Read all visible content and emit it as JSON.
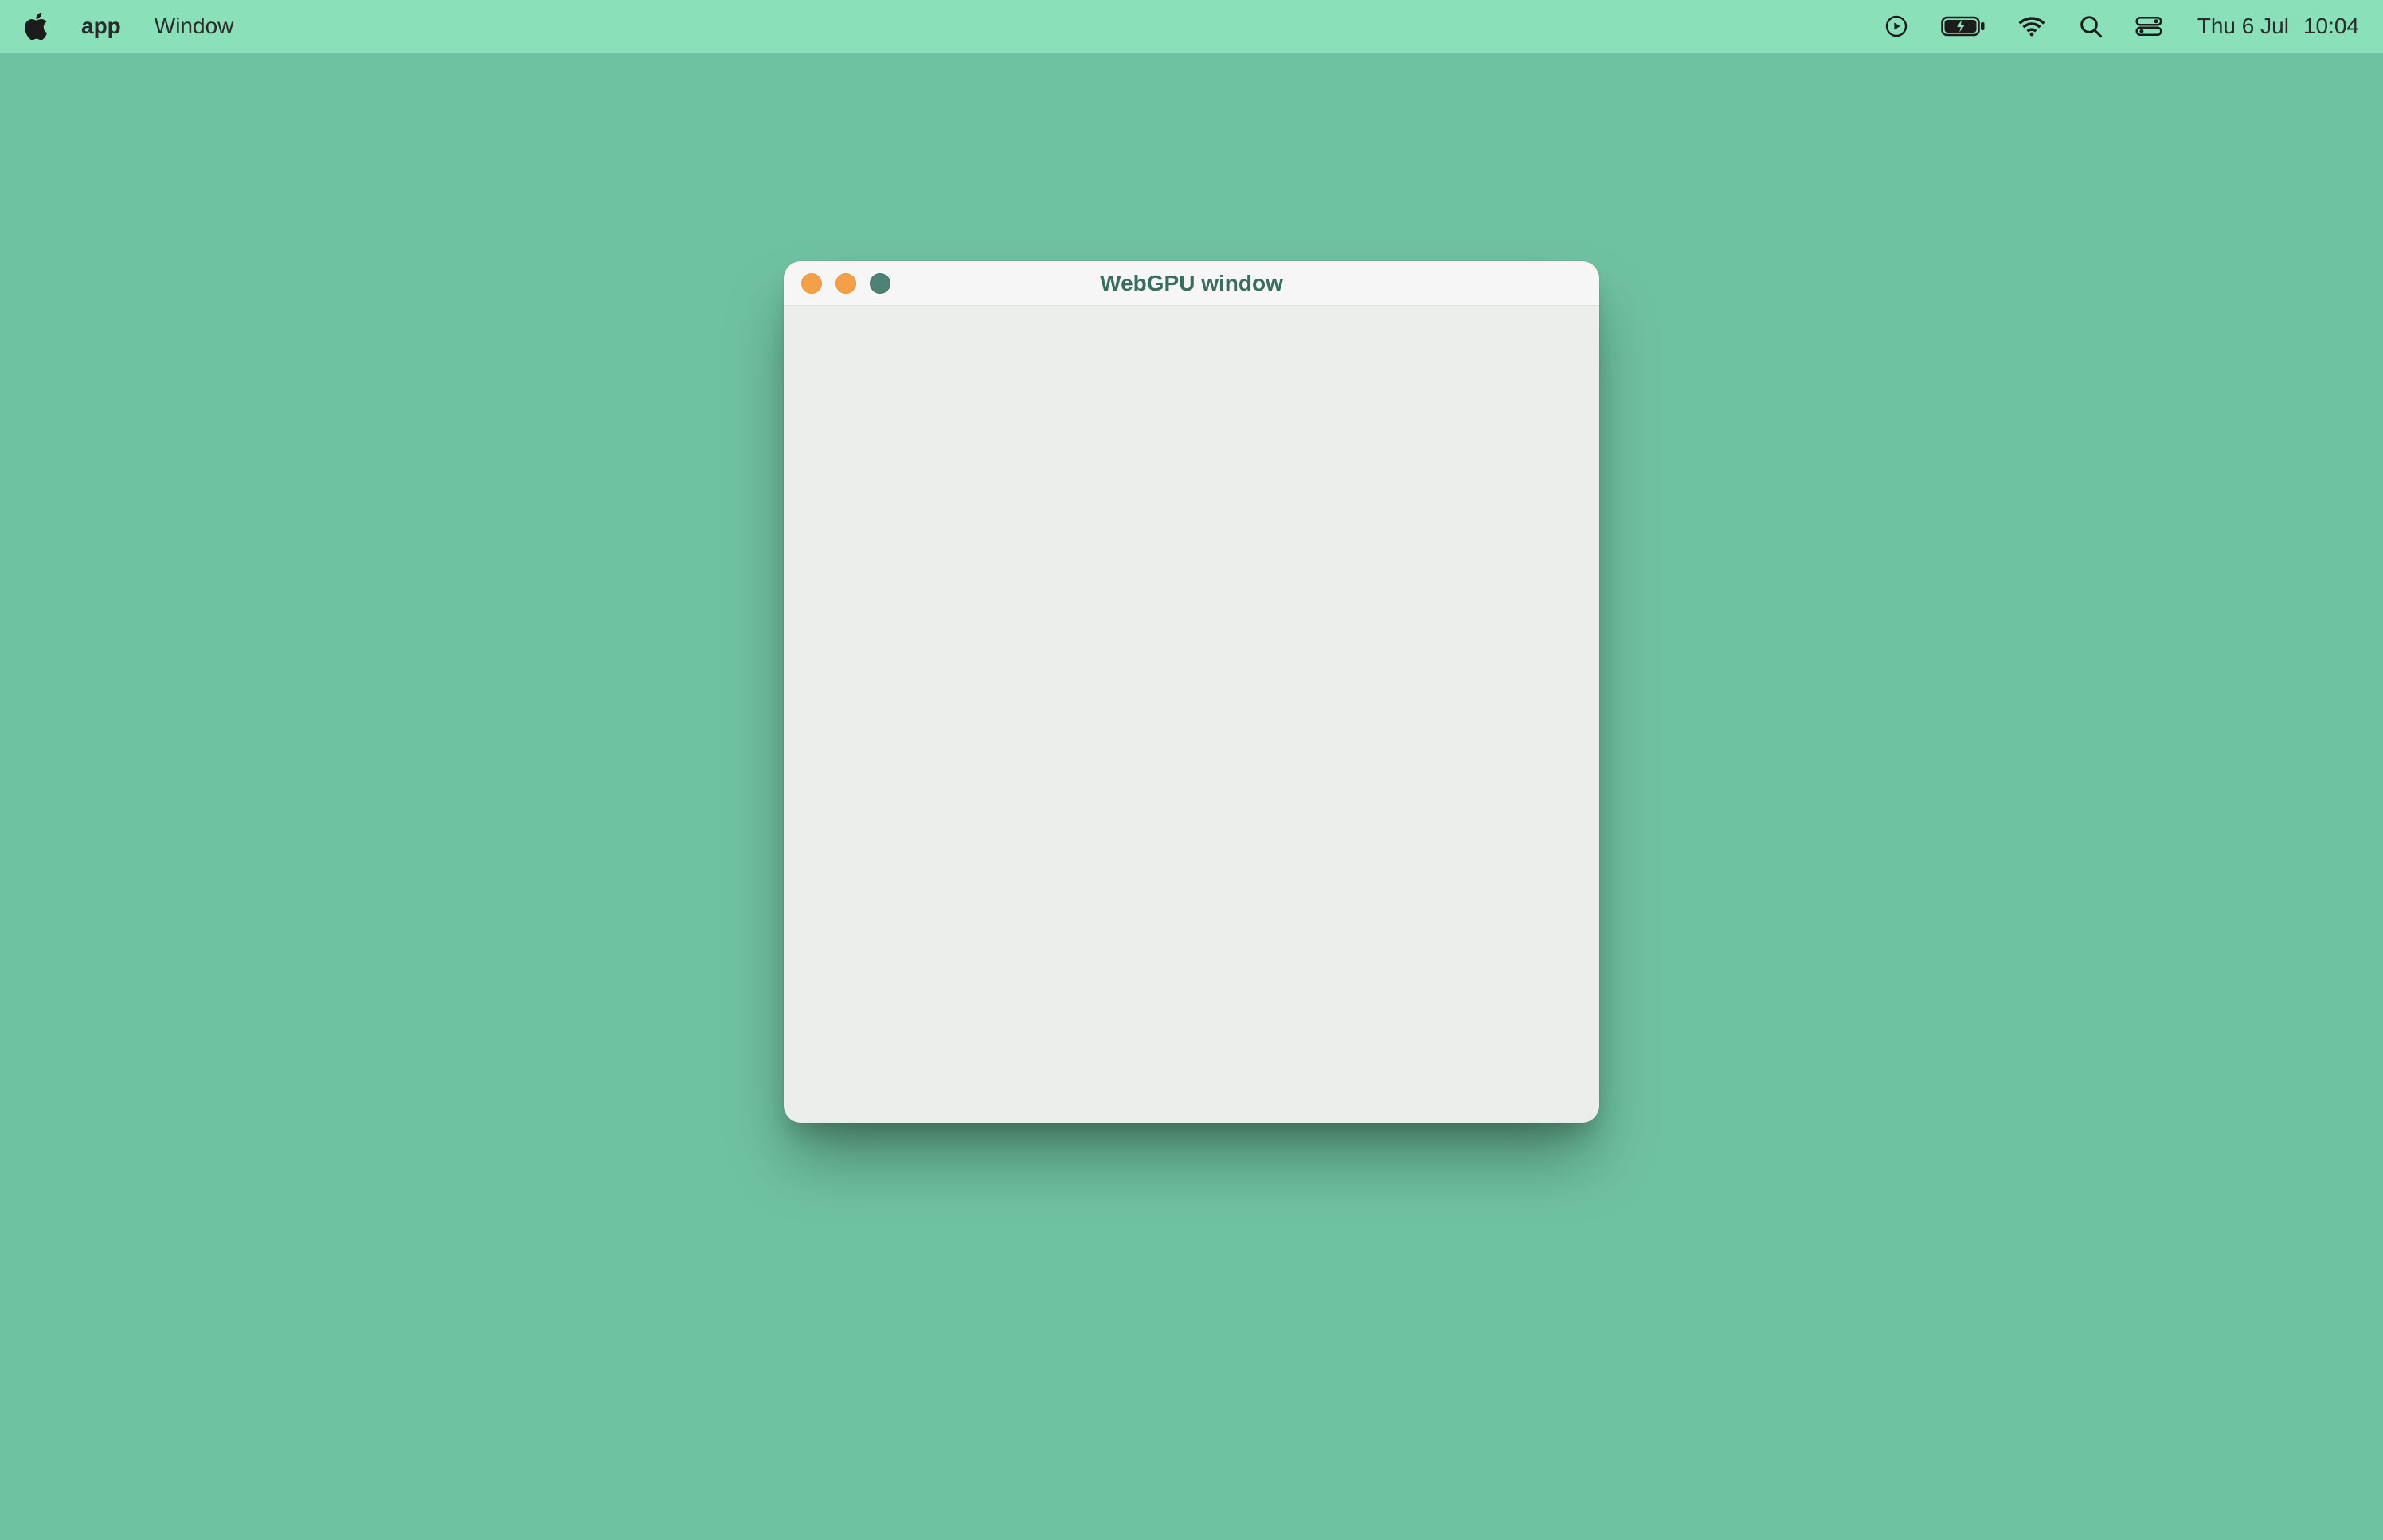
{
  "menubar": {
    "app_name": "app",
    "menus": [
      "Window"
    ],
    "date": "Thu 6 Jul",
    "time": "10:04"
  },
  "window": {
    "title": "WebGPU window"
  }
}
